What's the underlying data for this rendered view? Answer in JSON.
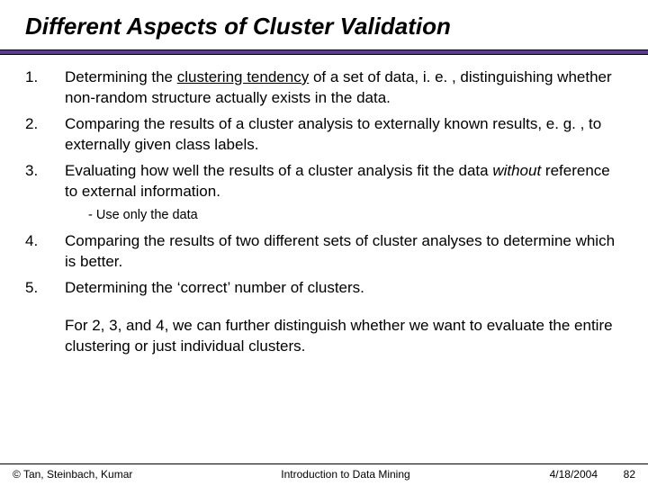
{
  "title": "Different Aspects of Cluster Validation",
  "items": [
    {
      "num": "1.",
      "pre": "Determining the ",
      "u": "clustering tendency",
      "post": " of a set of data, i. e. , distinguishing whether non-random structure actually exists in the data."
    },
    {
      "num": "2.",
      "pre": "Comparing the results of a cluster analysis to externally known results, e. g. , to externally given class labels.",
      "u": "",
      "post": ""
    },
    {
      "num": "3.",
      "pre": "Evaluating how well the results of a cluster analysis fit the data ",
      "i": "without",
      "post": " reference to external information."
    }
  ],
  "sub": "- Use only the data",
  "items2": [
    {
      "num": "4.",
      "text": "Comparing the results of two different sets of cluster analyses to determine which is better."
    },
    {
      "num": "5.",
      "text": "Determining the ‘correct’ number of clusters."
    }
  ],
  "closing": "For 2, 3, and 4, we can further distinguish whether we want to evaluate the entire clustering or just individual clusters.",
  "footer": {
    "left": "© Tan, Steinbach, Kumar",
    "center": "Introduction to Data Mining",
    "date": "4/18/2004",
    "page": "82"
  }
}
